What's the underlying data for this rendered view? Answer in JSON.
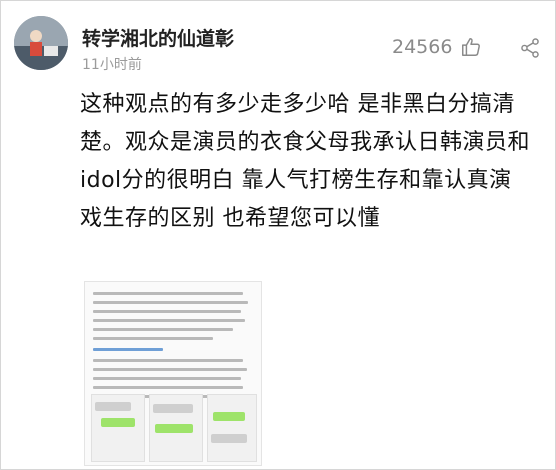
{
  "post": {
    "username": "转学湘北的仙道彰",
    "time": "11小时前",
    "likes": "24566",
    "content": "这种观点的有多少走多少哈 是非黑白分搞清楚。观众是演员的衣食父母我承认日韩演员和idol分的很明白 靠人气打榜生存和靠认真演戏生存的区别 也希望您可以懂"
  },
  "icons": {
    "like": "thumbs-up-icon",
    "share": "share-icon"
  },
  "colors": {
    "username": "#222222",
    "meta": "#9b9b9b",
    "link_blue": "#6f9fd6"
  }
}
